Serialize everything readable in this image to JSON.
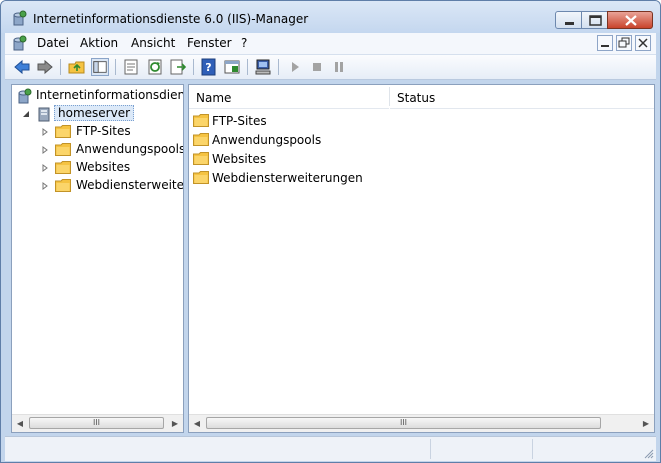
{
  "window": {
    "title": "Internetinformationsdienste 6.0 (IIS)-Manager"
  },
  "menubar": {
    "items": [
      "Datei",
      "Aktion",
      "Ansicht",
      "Fenster",
      "?"
    ]
  },
  "tree": {
    "root_label": "Internetinformationsdienste",
    "server_label": "homeserver",
    "children": [
      "FTP-Sites",
      "Anwendungspools",
      "Websites",
      "Webdiensterweiterungen"
    ]
  },
  "list": {
    "columns": [
      "Name",
      "Status"
    ],
    "rows": [
      "FTP-Sites",
      "Anwendungspools",
      "Websites",
      "Webdiensterweiterungen"
    ]
  },
  "scrollbar": {
    "thumb_grip": "III",
    "left_arrow": "◀",
    "right_arrow": "▶"
  },
  "colors": {
    "folder": "#f5c342",
    "accent": "#2f6fc6"
  }
}
